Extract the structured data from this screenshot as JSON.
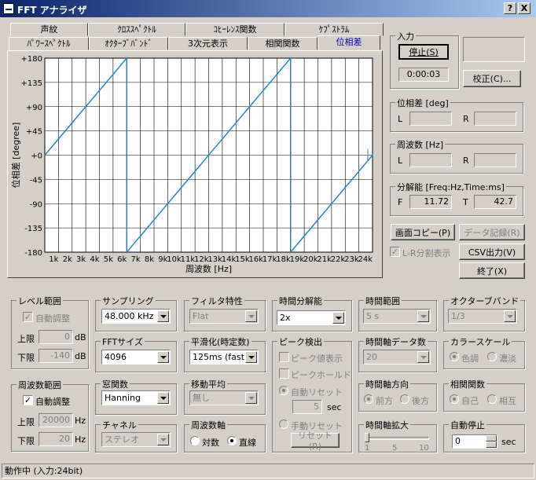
{
  "window": {
    "title": "FFT アナライザ",
    "help_btn": "?",
    "close_btn": "X"
  },
  "tabs_row1": [
    "声紋",
    "ｸﾛｽｽﾍﾟｸﾄﾙ",
    "ｺﾋｰﾚﾝｽ関数",
    "ｹﾌﾟｽﾄﾗﾑ"
  ],
  "tabs_row2": [
    "ﾊﾟﾜｰｽﾍﾟｸﾄﾙ",
    "ｵｸﾀｰﾌﾞﾊﾞﾝﾄﾞ",
    "3次元表示",
    "相関関数",
    "位相差"
  ],
  "chart_data": {
    "type": "line",
    "title": "",
    "xlabel": "周波数 [Hz]",
    "ylabel": "位相差 [degree]",
    "x_ticks": [
      "1k",
      "2k",
      "3k",
      "4k",
      "5k",
      "6k",
      "7k",
      "8k",
      "9k",
      "10k",
      "11k",
      "12k",
      "13k",
      "14k",
      "15k",
      "16k",
      "17k",
      "18k",
      "19k",
      "20k",
      "21k",
      "22k",
      "23k",
      "24k"
    ],
    "y_ticks": [
      "+180",
      "+135",
      "+90",
      "+45",
      "+0",
      "-45",
      "-90",
      "-135",
      "-180"
    ],
    "xlim": [
      0,
      24000
    ],
    "ylim": [
      -180,
      180
    ],
    "grid": true,
    "color": "#1e86c8",
    "series": [
      {
        "x": [
          0,
          6000,
          6000,
          18000,
          18000,
          24000
        ],
        "y": [
          0,
          180,
          -180,
          180,
          -180,
          0
        ]
      }
    ]
  },
  "input": {
    "label": "入力",
    "stop_btn": "停止(S)",
    "time": "0:00:03",
    "calib_btn": "校正(C)..."
  },
  "phase": {
    "label": "位相差 [deg]",
    "L": "L",
    "R": "R",
    "l_value": "",
    "r_value": ""
  },
  "freq": {
    "label": "周波数 [Hz]",
    "L": "L",
    "R": "R",
    "l_value": "",
    "r_value": ""
  },
  "resolution": {
    "label": "分解能 [Freq:Hz,Time:ms]",
    "F": "F",
    "f_value": "11.72",
    "T": "T",
    "t_value": "42.7"
  },
  "buttons": {
    "copy": "画面コピー(P)",
    "record": "データ記録(R)",
    "csv": "CSV出力(V)",
    "exit": "終了(X)",
    "lr_split": "L-R分割表示"
  },
  "level": {
    "label": "レベル範囲",
    "auto": "自動調整",
    "upper": "上限",
    "upper_value": "0",
    "lower": "下限",
    "lower_value": "-140",
    "unit": "dB"
  },
  "freq_range": {
    "label": "周波数範囲",
    "auto": "自動調整",
    "upper": "上限",
    "upper_value": "20000",
    "lower": "下限",
    "lower_value": "20",
    "unit": "Hz"
  },
  "sampling": {
    "label": "サンプリング",
    "value": "48.000 kHz"
  },
  "fft_size": {
    "label": "FFTサイズ",
    "value": "4096"
  },
  "window_fn": {
    "label": "窓関数",
    "value": "Hanning"
  },
  "channel": {
    "label": "チャネル",
    "value": "ステレオ"
  },
  "filter": {
    "label": "フィルタ特性",
    "value": "Flat"
  },
  "smoothing": {
    "label": "平滑化(時定数)",
    "value": "125ms (fast)"
  },
  "moving_avg": {
    "label": "移動平均",
    "value": "無し"
  },
  "freq_axis": {
    "label": "周波数軸",
    "log": "対数",
    "linear": "直線"
  },
  "time_res": {
    "label": "時間分解能",
    "value": "2x"
  },
  "peak": {
    "label": "ピーク検出",
    "show": "ピーク値表示",
    "hold": "ピークホールド",
    "auto_reset": "自動リセット",
    "sec_value": "5",
    "sec": "sec",
    "manual_reset": "手動リセット",
    "reset_btn": "リセット(R)"
  },
  "time_range": {
    "label": "時間範囲",
    "value": "5 s"
  },
  "time_data": {
    "label": "時間軸データ数",
    "value": "20"
  },
  "time_dir": {
    "label": "時間軸方向",
    "forward": "前方",
    "backward": "後方"
  },
  "time_zoom": {
    "label": "時間軸拡大",
    "t1": "1",
    "t5": "5",
    "t10": "10",
    "level": 0
  },
  "octave": {
    "label": "オクターブバンド",
    "value": "1/3"
  },
  "color_scale": {
    "label": "カラースケール",
    "hue": "色調",
    "shade": "濃淡"
  },
  "correlation": {
    "label": "相関関数",
    "self": "自己",
    "mutual": "相互"
  },
  "auto_stop": {
    "label": "自動停止",
    "value": "0",
    "sec": "sec"
  },
  "status": "動作中 (入力:24bit)"
}
